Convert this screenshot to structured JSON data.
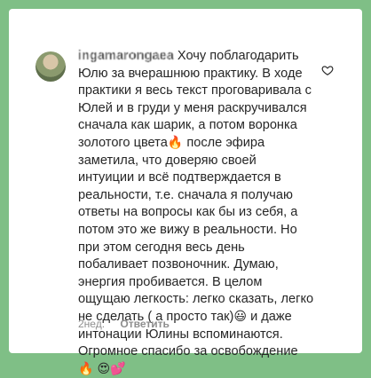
{
  "comment": {
    "username": "ingamarongaea",
    "text_part1": " Хочу поблагодарить Юлю за вчерашнюю практику. В ходе практики я весь текст проговаривала с Юлей и в груди у меня раскручивался сначала как шарик, а потом воронка золотого цвета",
    "text_part2": "после эфира заметила, что доверяю своей интуиции и всё подтверждается в реальности, т.е. сначала я получаю ответы на вопросы как бы из себя, а потом это же вижу в реальности. Но при этом сегодня весь день побаливает позвоночник. Думаю, энергия пробивается. В целом ощущаю легкость: легко сказать, легко не сделать ( а просто так)",
    "text_part3": " и даже интонации Юлины вспоминаются. Огромное спасибо за освобождение ",
    "emoji_fire": "🔥",
    "emoji_smile": "😃",
    "emoji_heart_eyes": "😍",
    "emoji_hearts": "💕"
  },
  "meta": {
    "time": "2нед.",
    "reply_label": "Ответить"
  },
  "colors": {
    "border": "#7fbf86",
    "text": "#262626",
    "secondary": "#8e8e8e"
  },
  "icons": {
    "like": "heart-outline-icon",
    "avatar": "profile-avatar"
  }
}
